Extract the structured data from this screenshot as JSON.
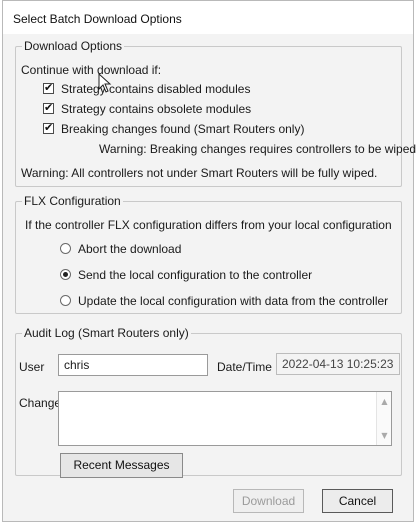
{
  "dialog": {
    "title": "Select Batch Download Options"
  },
  "download_options": {
    "legend": "Download Options",
    "intro": "Continue with download if:",
    "checkboxes": [
      {
        "label": "Strategy contains disabled modules",
        "checked": true
      },
      {
        "label": "Strategy contains obsolete modules",
        "checked": true
      },
      {
        "label": "Breaking changes found (Smart Routers only)",
        "checked": true
      }
    ],
    "breaking_warning": "Warning: Breaking changes requires controllers to be wiped.",
    "general_warning": "Warning: All controllers not under Smart Routers will be fully wiped."
  },
  "flx": {
    "legend": "FLX Configuration",
    "prompt": "If the controller FLX configuration differs from your local configuration",
    "options": [
      {
        "label": "Abort the download",
        "selected": false
      },
      {
        "label": "Send the local configuration to the controller",
        "selected": true
      },
      {
        "label": "Update the local configuration with data from the controller",
        "selected": false
      }
    ]
  },
  "audit": {
    "legend": "Audit Log (Smart Routers only)",
    "user_label": "User",
    "user_value": "chris",
    "datetime_label": "Date/Time",
    "datetime_value": "2022-04-13 10:25:23",
    "change_label": "Change",
    "change_value": "",
    "recent_messages_label": "Recent Messages"
  },
  "footer": {
    "download_label": "Download",
    "cancel_label": "Cancel"
  }
}
